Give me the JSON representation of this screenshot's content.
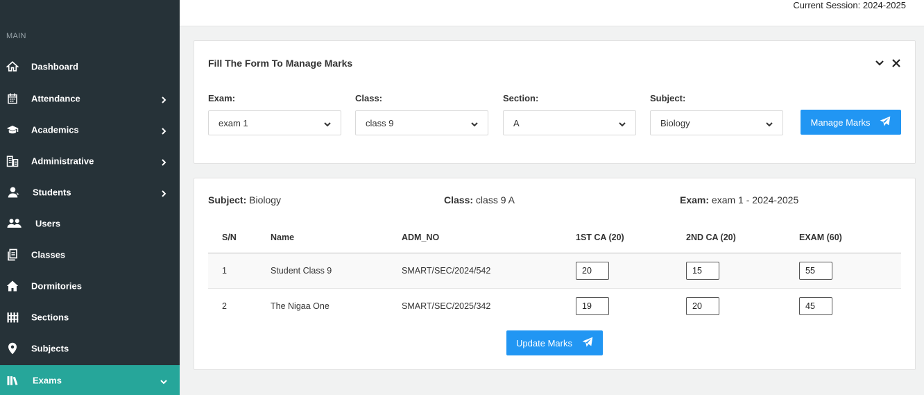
{
  "sidebar": {
    "heading": "MAIN",
    "items": [
      {
        "label": "Dashboard",
        "icon": "home-icon",
        "chevron": false
      },
      {
        "label": "Attendance",
        "icon": "calendar-icon",
        "chevron": true
      },
      {
        "label": "Academics",
        "icon": "graduation-cap-icon",
        "chevron": true
      },
      {
        "label": "Administrative",
        "icon": "building-icon",
        "chevron": true
      },
      {
        "label": "Students",
        "icon": "user-icon",
        "chevron": true
      },
      {
        "label": "Users",
        "icon": "users-icon",
        "chevron": false
      },
      {
        "label": "Classes",
        "icon": "clipboard-icon",
        "chevron": false
      },
      {
        "label": "Dormitories",
        "icon": "house-icon",
        "chevron": false
      },
      {
        "label": "Sections",
        "icon": "fence-icon",
        "chevron": false
      },
      {
        "label": "Subjects",
        "icon": "map-pin-icon",
        "chevron": false
      },
      {
        "label": "Exams",
        "icon": "books-icon",
        "chevron": true,
        "active": true
      }
    ],
    "active_color": "#26a69a"
  },
  "header": {
    "session": "Current Session: 2024-2025"
  },
  "form_card": {
    "title": "Fill The Form To Manage Marks",
    "fields": {
      "exam": {
        "label": "Exam:",
        "value": "exam 1"
      },
      "class": {
        "label": "Class:",
        "value": "class 9"
      },
      "section": {
        "label": "Section:",
        "value": "A"
      },
      "subject": {
        "label": "Subject:",
        "value": "Biology"
      }
    },
    "submit_label": "Manage Marks"
  },
  "marks_card": {
    "subject_label": "Subject:",
    "subject_value": " Biology",
    "class_label": "Class:",
    "class_value": " class 9 A",
    "exam_label": "Exam:",
    "exam_value": " exam 1 - 2024-2025",
    "columns": [
      "S/N",
      "Name",
      "ADM_NO",
      "1ST CA (20)",
      "2ND CA (20)",
      "EXAM (60)"
    ],
    "rows": [
      {
        "sn": "1",
        "name": "Student Class 9",
        "adm_no": "SMART/SEC/2024/542",
        "ca1": "20",
        "ca2": "15",
        "exam": "55"
      },
      {
        "sn": "2",
        "name": "The Nigaa One",
        "adm_no": "SMART/SEC/2025/342",
        "ca1": "19",
        "ca2": "20",
        "exam": "45"
      }
    ],
    "update_label": "Update Marks"
  },
  "colors": {
    "sidebar_bg": "#263238",
    "primary_button": "#2196f3"
  }
}
